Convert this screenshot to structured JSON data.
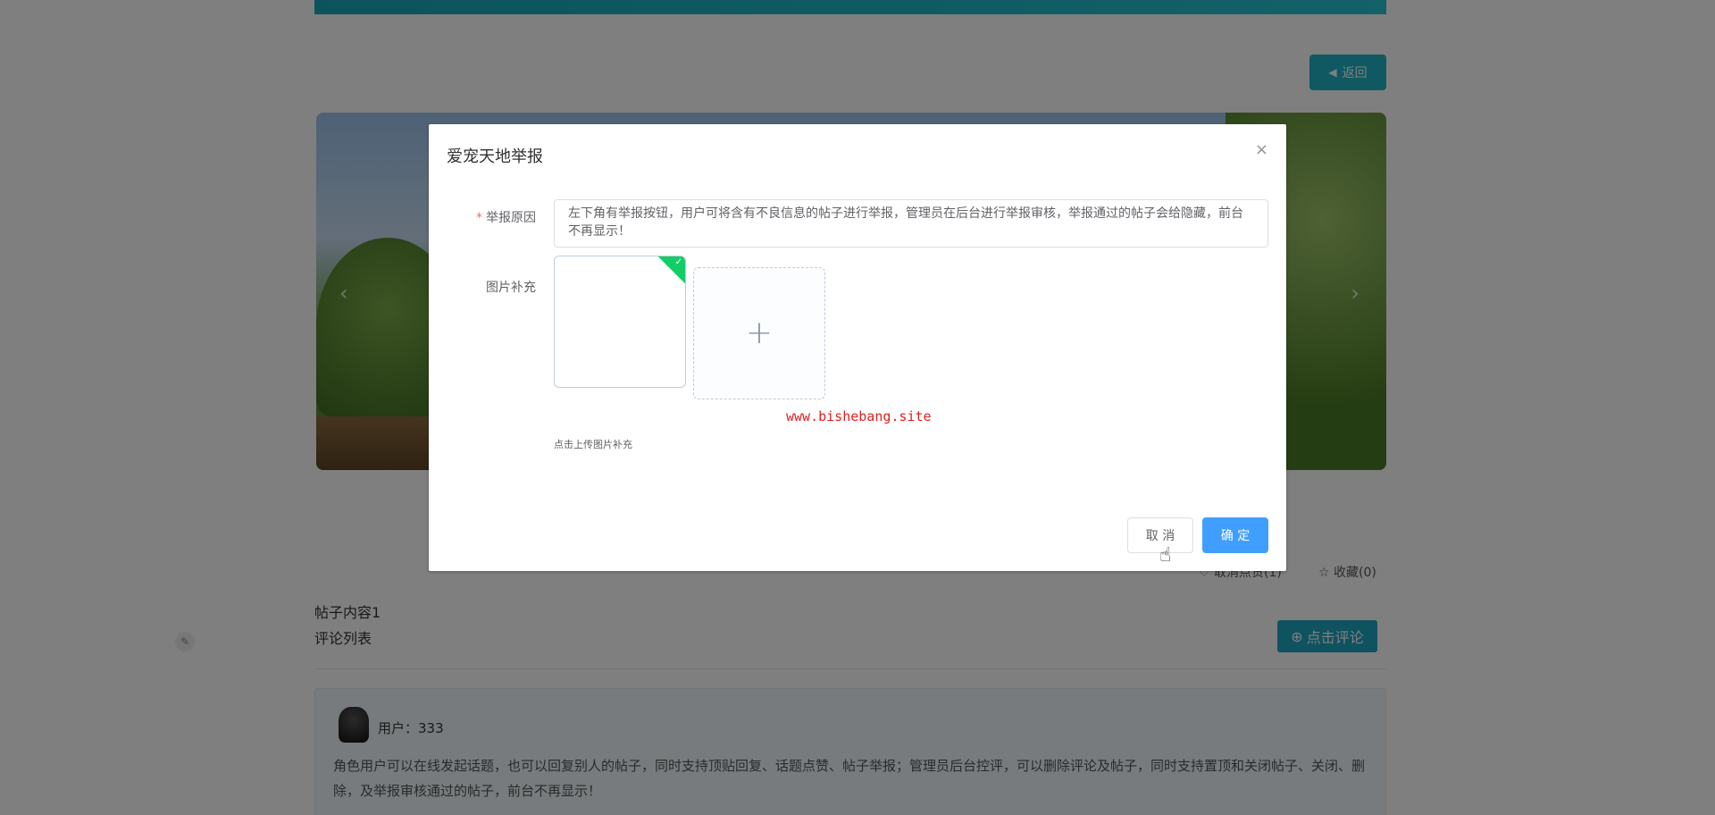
{
  "page": {
    "back_label": "返回",
    "like_label": "取消点赞(1)",
    "fav_label": "收藏(0)",
    "post_title": "帖子内容1",
    "comment_list_title": "评论列表",
    "comment_button_label": "点击评论",
    "comments": [
      {
        "user": "用户：333",
        "text": "角色用户可以在线发起话题，也可以回复别人的帖子，同时支持顶贴回复、话题点赞、帖子举报；管理员后台控评，可以删除评论及帖子，同时支持置顶和关闭帖子、关闭、删除，及举报审核通过的帖子，前台不再显示！"
      }
    ],
    "icons": {
      "back": "chevron-left-icon",
      "like": "heart-icon",
      "fav": "star-icon",
      "comment": "plus-circle-icon",
      "edit": "edit-icon"
    }
  },
  "dialog": {
    "title": "爱宠天地举报",
    "close_glyph": "×",
    "reason_label": "举报原因",
    "required_mark": "*",
    "reason_value": "左下角有举报按钮，用户可将含有不良信息的帖子进行举报，管理员在后台进行举报审核，举报通过的帖子会给隐藏，前台不再显示！",
    "image_label": "图片补充",
    "upload_tip": "点击上传图片补充",
    "watermark": "www.bishebang.site",
    "cancel_label": "取 消",
    "ok_label": "确 定"
  },
  "colors": {
    "primary": "#409eff",
    "accent_teal": "#21b3c4",
    "required": "#f56c6c",
    "success": "#13ce66",
    "watermark": "#e02020"
  }
}
